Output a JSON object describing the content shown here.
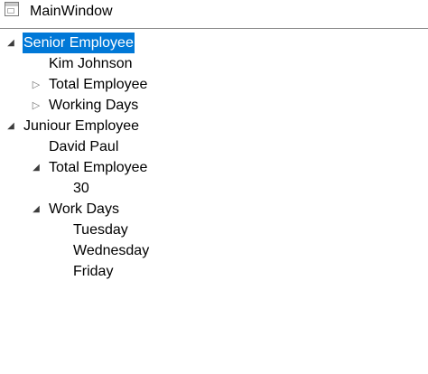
{
  "window": {
    "title": "MainWindow"
  },
  "tree": {
    "glyphs": {
      "expanded": "◢",
      "collapsed": "▷"
    },
    "senior": {
      "label": "Senior Employee",
      "name": "Kim Johnson",
      "total": {
        "label": "Total Employee"
      },
      "working_days": {
        "label": "Working Days"
      }
    },
    "junior": {
      "label": "Juniour Employee",
      "name": "David Paul",
      "total": {
        "label": "Total Employee",
        "value": "30"
      },
      "work_days": {
        "label": "Work Days",
        "days": [
          "Tuesday",
          "Wednesday",
          "Friday"
        ]
      }
    }
  }
}
